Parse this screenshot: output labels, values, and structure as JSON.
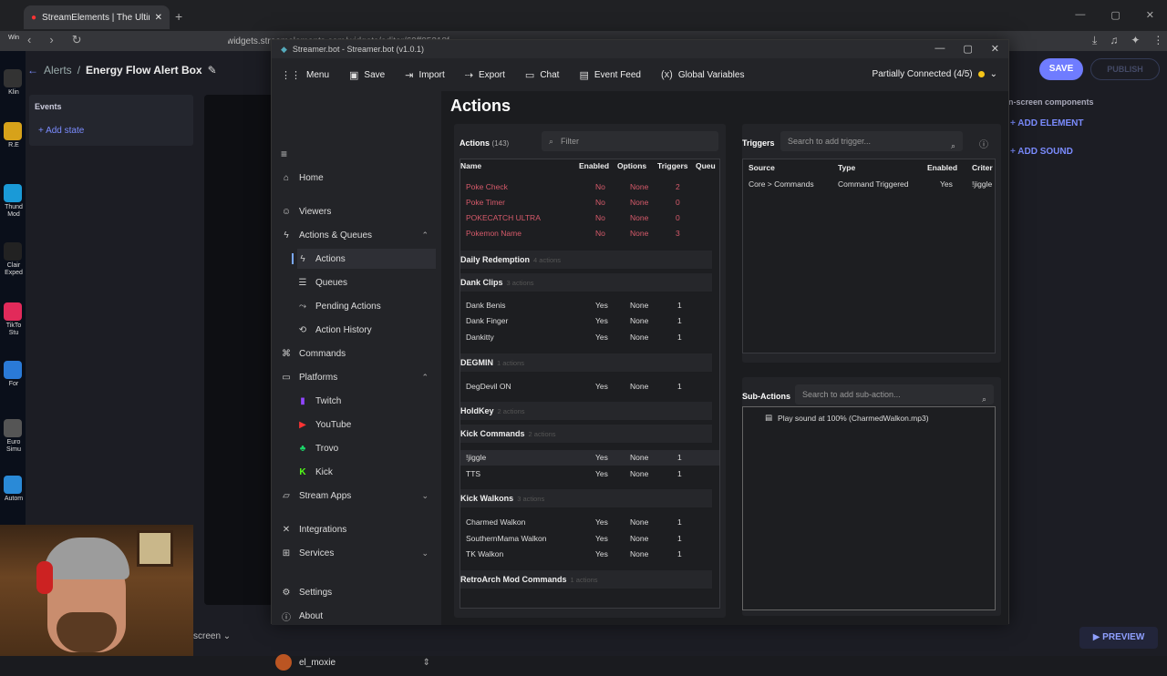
{
  "browser": {
    "tab_title": "StreamElements | The Ultimate S",
    "url": "widgets.streamelements.com/widgets/editor/69ff05318f...",
    "new_tab": "+"
  },
  "desktop": {
    "icons": [
      "Win",
      "Klin",
      "R.E",
      "Thund Mod",
      "Clair Exped",
      "TikTo Stu",
      "For",
      "Euro Simu",
      "Autom"
    ]
  },
  "se": {
    "breadcrumb_root": "Alerts",
    "breadcrumb_sep": "/",
    "breadcrumb_current": "Energy Flow Alert Box",
    "events_label": "Events",
    "add_state": "Add state",
    "save": "SAVE",
    "publish": "PUBLISH",
    "onscreen": "n-screen components",
    "add_element": "ADD ELEMENT",
    "add_sound": "ADD SOUND",
    "preview": "PREVIEW",
    "screen_label": "screen"
  },
  "sb": {
    "title": "Streamer.bot - Streamer.bot (v1.0.1)",
    "toolbar": {
      "menu": "Menu",
      "save": "Save",
      "import": "Import",
      "export": "Export",
      "chat": "Chat",
      "event_feed": "Event Feed",
      "global_variables": "Global Variables"
    },
    "connection": "Partially Connected (4/5)",
    "nav": {
      "home": "Home",
      "viewers": "Viewers",
      "actions_queues": "Actions & Queues",
      "actions": "Actions",
      "queues": "Queues",
      "pending_actions": "Pending Actions",
      "action_history": "Action History",
      "commands": "Commands",
      "platforms": "Platforms",
      "twitch": "Twitch",
      "youtube": "YouTube",
      "trovo": "Trovo",
      "kick": "Kick",
      "stream_apps": "Stream Apps",
      "integrations": "Integrations",
      "services": "Services",
      "settings": "Settings",
      "about": "About",
      "user": "el_moxie"
    },
    "page_title": "Actions",
    "actions_panel": {
      "label": "Actions",
      "count": "(143)",
      "filter_placeholder": "Filter",
      "headers": [
        "Name",
        "Enabled",
        "Options",
        "Triggers",
        "Queu"
      ],
      "top_rows": [
        {
          "name": "Poke Check",
          "enabled": "No",
          "options": "None",
          "triggers": "2"
        },
        {
          "name": "Poke Timer",
          "enabled": "No",
          "options": "None",
          "triggers": "0"
        },
        {
          "name": "POKECATCH ULTRA",
          "enabled": "No",
          "options": "None",
          "triggers": "0"
        },
        {
          "name": "Pokemon Name",
          "enabled": "No",
          "options": "None",
          "triggers": "3"
        }
      ],
      "groups": {
        "daily": {
          "name": "Daily Redemption",
          "count": "4 actions"
        },
        "dank": {
          "name": "Dank Clips",
          "count": "3 actions"
        },
        "degmin": {
          "name": "DEGMIN",
          "count": "1 actions"
        },
        "holdkey": {
          "name": "HoldKey",
          "count": "2 actions"
        },
        "kickcmd": {
          "name": "Kick Commands",
          "count": "2 actions"
        },
        "kickwalk": {
          "name": "Kick Walkons",
          "count": "3 actions"
        },
        "retro": {
          "name": "RetroArch Mod Commands",
          "count": "1 actions"
        }
      },
      "dank_rows": [
        {
          "name": "Dank Benis",
          "enabled": "Yes",
          "options": "None",
          "triggers": "1"
        },
        {
          "name": "Dank Finger",
          "enabled": "Yes",
          "options": "None",
          "triggers": "1"
        },
        {
          "name": "Dankitty",
          "enabled": "Yes",
          "options": "None",
          "triggers": "1"
        }
      ],
      "degmin_rows": [
        {
          "name": "DegDevil ON",
          "enabled": "Yes",
          "options": "None",
          "triggers": "1"
        }
      ],
      "kickcmd_rows": [
        {
          "name": "!jiggle",
          "enabled": "Yes",
          "options": "None",
          "triggers": "1"
        },
        {
          "name": "TTS",
          "enabled": "Yes",
          "options": "None",
          "triggers": "1"
        }
      ],
      "kickwalk_rows": [
        {
          "name": "Charmed Walkon",
          "enabled": "Yes",
          "options": "None",
          "triggers": "1"
        },
        {
          "name": "SouthernMama Walkon",
          "enabled": "Yes",
          "options": "None",
          "triggers": "1"
        },
        {
          "name": "TK Walkon",
          "enabled": "Yes",
          "options": "None",
          "triggers": "1"
        }
      ]
    },
    "triggers": {
      "label": "Triggers",
      "search_placeholder": "Search to add trigger...",
      "headers": [
        "Source",
        "Type",
        "Enabled",
        "Criter"
      ],
      "row": {
        "source": "Core > Commands",
        "type": "Command Triggered",
        "enabled": "Yes",
        "criteria": "!jiggle"
      }
    },
    "subactions": {
      "label": "Sub-Actions",
      "search_placeholder": "Search to add sub-action...",
      "item": "Play sound at 100% (CharmedWalkon.mp3)"
    }
  },
  "colors": {
    "accent": "#6f7cff",
    "disabled_red": "#d65a6a",
    "status_yellow": "#f5c518"
  }
}
